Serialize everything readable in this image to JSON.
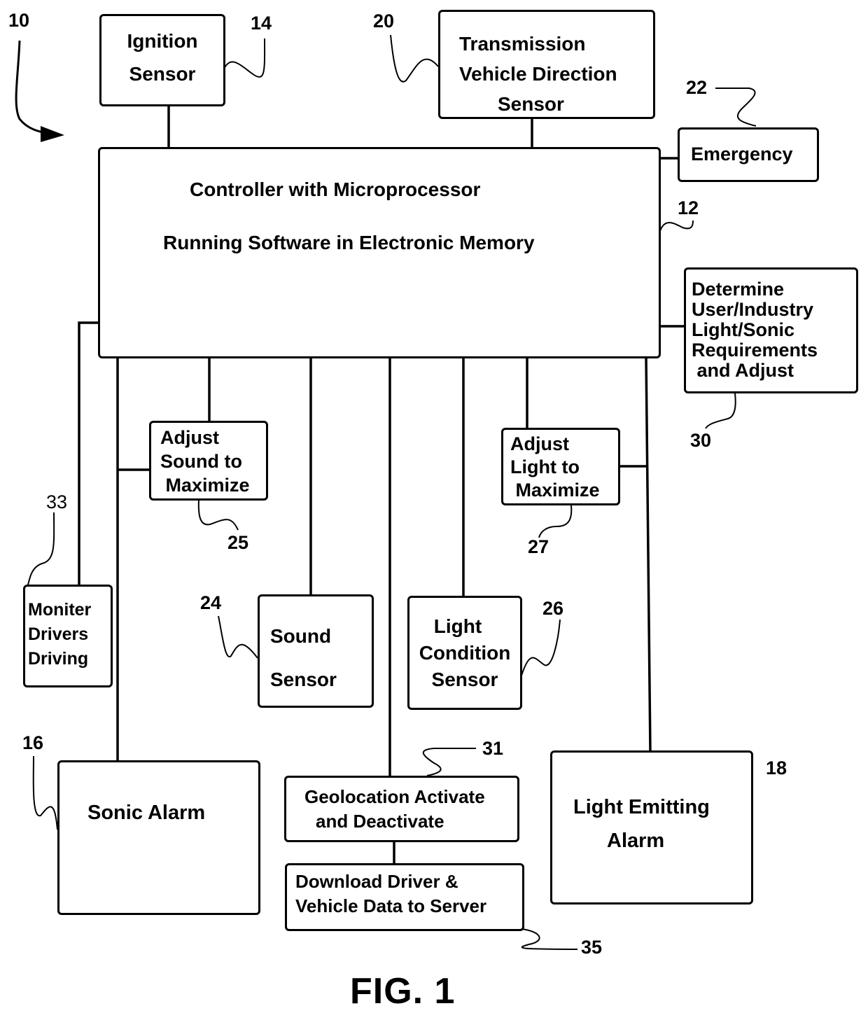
{
  "figure": {
    "caption": "FIG. 1",
    "system_ref": "10"
  },
  "blocks": {
    "ignition_sensor": {
      "ref": "14",
      "lines": [
        "Ignition",
        "Sensor"
      ]
    },
    "transmission_sensor": {
      "ref": "20",
      "lines": [
        "Transmission",
        "Vehicle Direction",
        "Sensor"
      ]
    },
    "emergency": {
      "ref": "22",
      "lines": [
        "Emergency"
      ]
    },
    "controller": {
      "ref": "12",
      "lines": [
        "Controller with Microprocessor",
        "Running Software in Electronic Memory"
      ]
    },
    "requirements": {
      "ref": "30",
      "lines": [
        "Determine",
        "User/Industry",
        "Light/Sonic",
        "Requirements",
        " and Adjust"
      ]
    },
    "adjust_sound": {
      "ref": "25",
      "lines": [
        "Adjust",
        "Sound to",
        " Maximize"
      ]
    },
    "adjust_light": {
      "ref": "27",
      "lines": [
        "Adjust",
        "Light to",
        " Maximize"
      ]
    },
    "monitor_drivers": {
      "ref": "33",
      "lines": [
        "Moniter",
        "Drivers",
        "Driving"
      ]
    },
    "sound_sensor": {
      "ref": "24",
      "lines": [
        "Sound",
        "Sensor"
      ]
    },
    "light_condition_sensor": {
      "ref": "26",
      "lines": [
        "Light",
        "Condition",
        "Sensor"
      ]
    },
    "sonic_alarm": {
      "ref": "16",
      "lines": [
        "Sonic Alarm"
      ]
    },
    "geolocation": {
      "ref": "31",
      "lines": [
        "Geolocation Activate",
        "and Deactivate"
      ]
    },
    "download_data": {
      "ref": "35",
      "lines": [
        "Download Driver &",
        "Vehicle Data to Server"
      ]
    },
    "light_emitting_alarm": {
      "ref": "18",
      "lines": [
        "Light Emitting",
        "Alarm"
      ]
    }
  },
  "colors": {
    "ink": "#000000",
    "paper": "#ffffff"
  }
}
